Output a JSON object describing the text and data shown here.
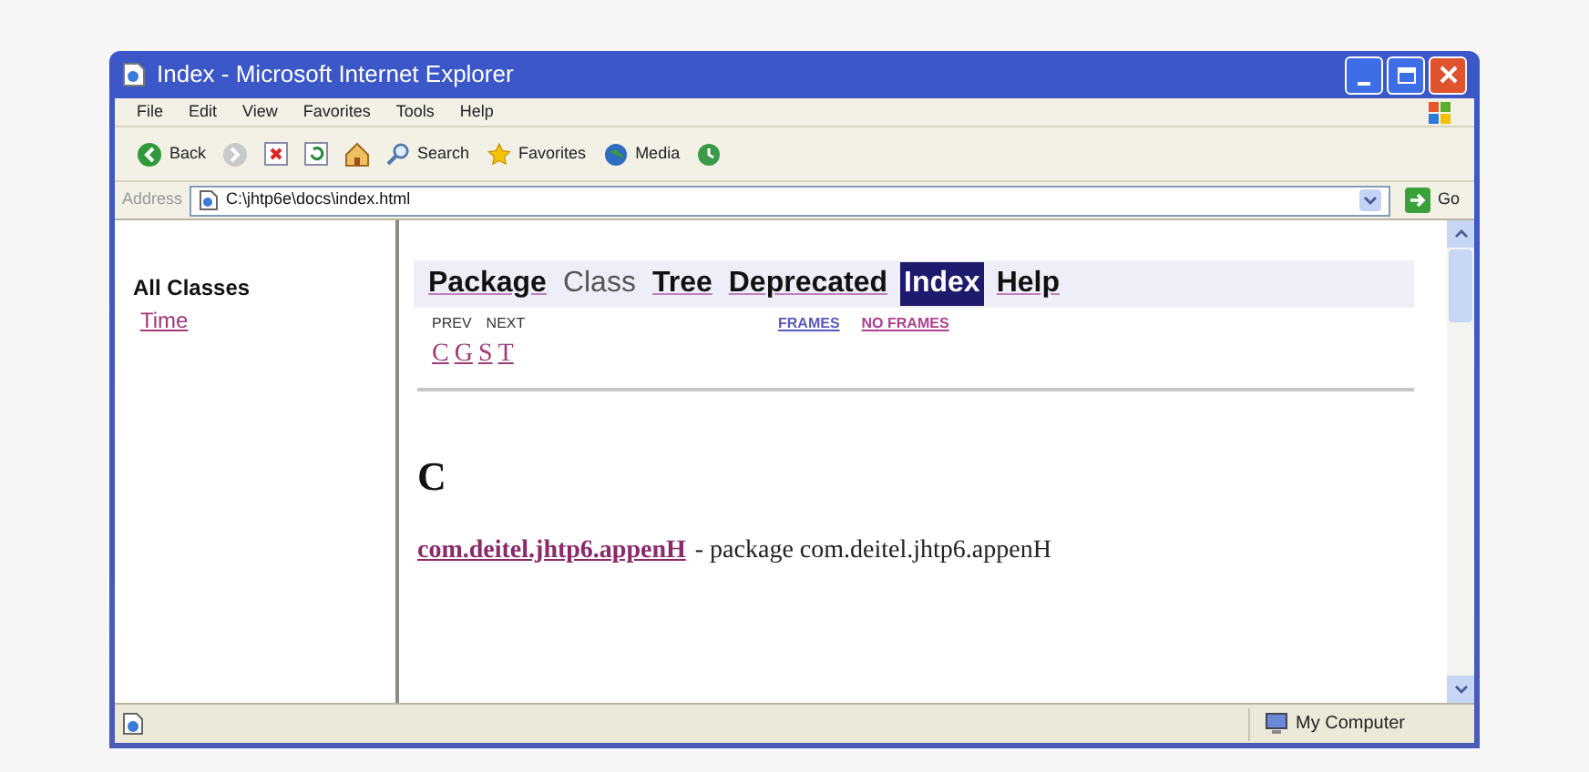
{
  "window": {
    "title": "Index - Microsoft Internet Explorer"
  },
  "menu": [
    "File",
    "Edit",
    "View",
    "Favorites",
    "Tools",
    "Help"
  ],
  "toolbar": [
    {
      "kind": "back",
      "label": "Back"
    },
    {
      "kind": "forward"
    },
    {
      "kind": "stop"
    },
    {
      "kind": "refresh"
    },
    {
      "kind": "home"
    },
    {
      "kind": "search",
      "label": "Search"
    },
    {
      "kind": "favorites",
      "label": "Favorites"
    },
    {
      "kind": "media",
      "label": "Media"
    },
    {
      "kind": "history"
    }
  ],
  "address": {
    "label": "Address",
    "value": "C:\\jhtp6e\\docs\\index.html",
    "go": "Go"
  },
  "left_frame": {
    "heading": "All Classes",
    "links": [
      "Time"
    ]
  },
  "nav_bar": [
    {
      "label": "Package",
      "kind": "link",
      "selected": false
    },
    {
      "label": "Class",
      "kind": "plain",
      "selected": false
    },
    {
      "label": "Tree",
      "kind": "link",
      "selected": false
    },
    {
      "label": "Deprecated",
      "kind": "link",
      "selected": false
    },
    {
      "label": "Index",
      "kind": "link",
      "selected": true
    },
    {
      "label": "Help",
      "kind": "link",
      "selected": false
    }
  ],
  "sub_nav": {
    "left": [
      "PREV",
      "NEXT"
    ],
    "right": [
      "FRAMES",
      "NO FRAMES"
    ]
  },
  "letters": [
    "C",
    "G",
    "S",
    "T"
  ],
  "section": {
    "heading": "C",
    "entry_link": "com.deitel.jhtp6.appenH",
    "entry_text": "- package com.deitel.jhtp6.appenH"
  },
  "status_bar": {
    "zone": "My Computer"
  }
}
